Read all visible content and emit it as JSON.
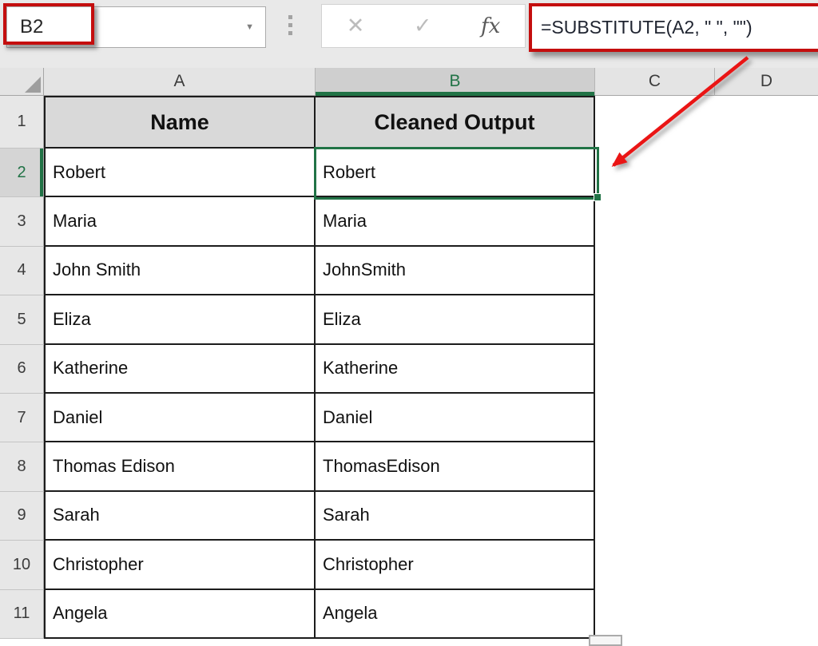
{
  "toolbar": {
    "name_box_value": "B2",
    "name_dropdown_icon": "▼",
    "cancel_icon": "✕",
    "enter_icon": "✓",
    "fx_icon": "fx",
    "formula": "=SUBSTITUTE(A2, \" \", \"\")"
  },
  "sheet": {
    "columns": [
      "A",
      "B",
      "C",
      "D"
    ],
    "header_row": {
      "row": "1",
      "name": "Name",
      "cleaned": "Cleaned Output"
    },
    "data_rows": [
      {
        "row": "2",
        "name": "Robert",
        "cleaned": "Robert"
      },
      {
        "row": "3",
        "name": "Maria",
        "cleaned": "Maria"
      },
      {
        "row": "4",
        "name": "John Smith",
        "cleaned": "JohnSmith"
      },
      {
        "row": "5",
        "name": "Eliza",
        "cleaned": "Eliza"
      },
      {
        "row": "6",
        "name": "Katherine",
        "cleaned": "Katherine"
      },
      {
        "row": "7",
        "name": "Daniel",
        "cleaned": "Daniel"
      },
      {
        "row": "8",
        "name": "Thomas Edison",
        "cleaned": "ThomasEdison"
      },
      {
        "row": "9",
        "name": "Sarah",
        "cleaned": "Sarah"
      },
      {
        "row": "10",
        "name": "Christopher",
        "cleaned": "Christopher"
      },
      {
        "row": "11",
        "name": "Angela",
        "cleaned": "Angela"
      }
    ],
    "selection": {
      "cell": "B2",
      "column": "B",
      "row": "2"
    }
  },
  "colors": {
    "selection_green": "#217346",
    "annotation_red": "#c40e0e",
    "arrow_red": "#ea1515",
    "table_header_fill": "#d9d9d9",
    "column_header_fill": "#e4e4e4"
  }
}
